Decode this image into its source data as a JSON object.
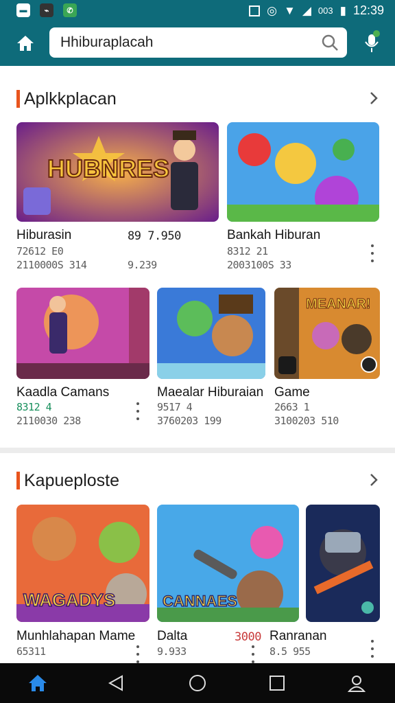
{
  "search": {
    "value": "Hhiburaplacah"
  },
  "sections": [
    {
      "title": "Aplkkplacan",
      "row1": [
        {
          "name": "Hiburasin",
          "meta1": "72612 E0",
          "meta2": "2110000S 314",
          "extra_top": "89  7.950",
          "extra_bot": "9.239"
        },
        {
          "name": "Bankah Hiburan",
          "meta1": "8312 21",
          "meta2": "2003100S 33"
        }
      ],
      "row2": [
        {
          "name": "Kaadla Camans",
          "meta1": "8312 4",
          "meta2": "2110030 238"
        },
        {
          "name": "Maealar Hiburaian",
          "meta1": "9517 4",
          "meta2": "3760203 199"
        },
        {
          "name": "Game",
          "meta1": "2663 1",
          "meta2": "3100203 510"
        }
      ],
      "thumb_text_a": "HUBNRES",
      "thumb_text_b": "MEANAR!"
    },
    {
      "title": "Kapueploste",
      "row1": [
        {
          "name": "Munhlahapan Mame",
          "meta1": "65311"
        },
        {
          "name": "Dalta",
          "meta1": "9.933",
          "extra": "3000"
        },
        {
          "name": "Ranranan",
          "meta1": "8.5 955"
        }
      ],
      "thumb_text_a": "WAGADYS",
      "thumb_text_b": "CANNAES"
    }
  ],
  "status": {
    "time": "12:39",
    "carrier": "003"
  },
  "colors": {
    "appbar": "#0e6b7a",
    "accent": "#e8541d",
    "green_meta": "#178f5c"
  }
}
